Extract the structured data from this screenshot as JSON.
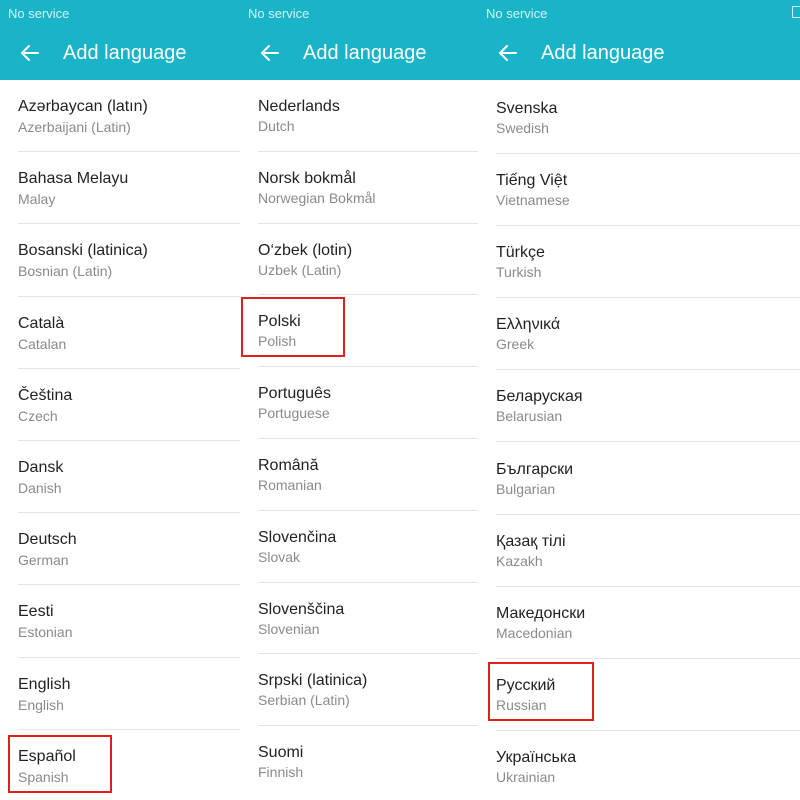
{
  "panels": [
    {
      "status_text": "No service",
      "title": "Add language",
      "items": [
        {
          "name": "Azərbaycan (latın)",
          "sub": "Azerbaijani (Latin)"
        },
        {
          "name": "Bahasa Melayu",
          "sub": "Malay"
        },
        {
          "name": "Bosanski (latinica)",
          "sub": "Bosnian (Latin)"
        },
        {
          "name": "Català",
          "sub": "Catalan"
        },
        {
          "name": "Čeština",
          "sub": "Czech"
        },
        {
          "name": "Dansk",
          "sub": "Danish"
        },
        {
          "name": "Deutsch",
          "sub": "German"
        },
        {
          "name": "Eesti",
          "sub": "Estonian"
        },
        {
          "name": "English",
          "sub": "English"
        },
        {
          "name": "Español",
          "sub": "Spanish",
          "highlighted": true
        }
      ]
    },
    {
      "status_text": "No service",
      "title": "Add language",
      "items": [
        {
          "name": "Nederlands",
          "sub": "Dutch"
        },
        {
          "name": "Norsk bokmål",
          "sub": "Norwegian Bokmål"
        },
        {
          "name": "O‘zbek (lotin)",
          "sub": "Uzbek (Latin)"
        },
        {
          "name": "Polski",
          "sub": "Polish",
          "highlighted": true
        },
        {
          "name": "Português",
          "sub": "Portuguese"
        },
        {
          "name": "Română",
          "sub": "Romanian"
        },
        {
          "name": "Slovenčina",
          "sub": "Slovak"
        },
        {
          "name": "Slovenščina",
          "sub": "Slovenian"
        },
        {
          "name": "Srpski (latinica)",
          "sub": "Serbian (Latin)"
        },
        {
          "name": "Suomi",
          "sub": "Finnish"
        }
      ]
    },
    {
      "status_text": "No service",
      "title": "Add language",
      "items": [
        {
          "name": "Svenska",
          "sub": "Swedish"
        },
        {
          "name": "Tiếng Việt",
          "sub": "Vietnamese"
        },
        {
          "name": "Türkçe",
          "sub": "Turkish"
        },
        {
          "name": "Ελληνικά",
          "sub": "Greek"
        },
        {
          "name": "Беларуская",
          "sub": "Belarusian"
        },
        {
          "name": "Български",
          "sub": "Bulgarian"
        },
        {
          "name": "Қазақ тілі",
          "sub": "Kazakh"
        },
        {
          "name": "Македонски",
          "sub": "Macedonian"
        },
        {
          "name": "Русский",
          "sub": "Russian",
          "highlighted": true
        },
        {
          "name": "Українська",
          "sub": "Ukrainian"
        }
      ]
    }
  ],
  "colors": {
    "appbar": "#1ab4c8",
    "highlight": "#e02020",
    "primary_text": "#222222",
    "secondary_text": "#8a8a8a"
  },
  "icons": {
    "back": "arrow-left-icon"
  }
}
